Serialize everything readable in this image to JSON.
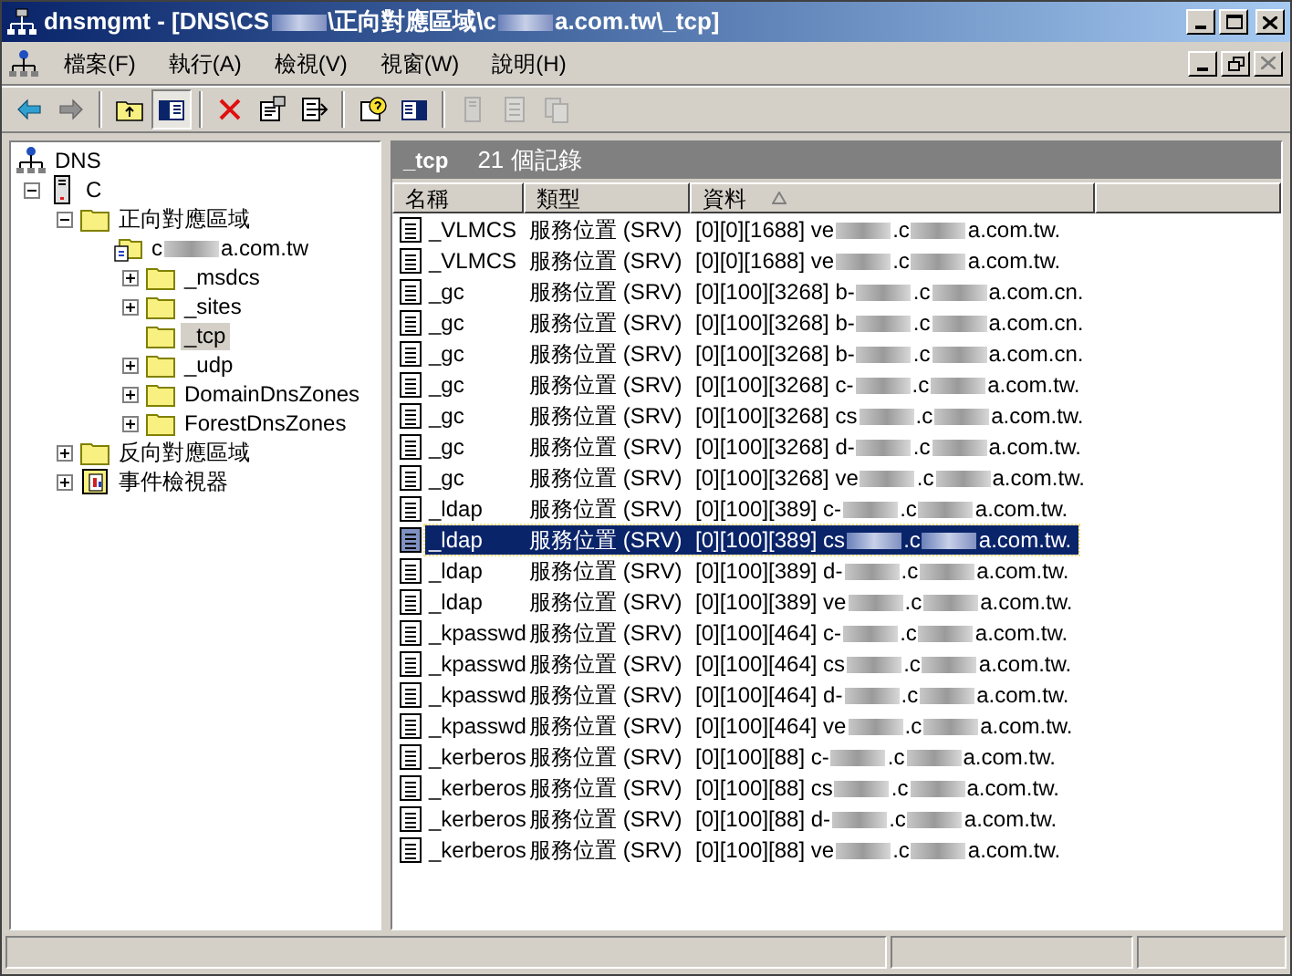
{
  "window": {
    "title": [
      "dnsmgmt - [DNS\\CS",
      "\\正向對應區域\\c",
      "a.com.tw\\_tcp]"
    ]
  },
  "menu": [
    {
      "label": "檔案(F)"
    },
    {
      "label": "執行(A)"
    },
    {
      "label": "檢視(V)"
    },
    {
      "label": "視窗(W)"
    },
    {
      "label": "說明(H)"
    }
  ],
  "toolbar": [
    {
      "kind": "back",
      "disabled": false
    },
    {
      "kind": "forward",
      "disabled": false
    },
    {
      "kind": "sep"
    },
    {
      "kind": "up",
      "disabled": false
    },
    {
      "kind": "tree",
      "disabled": false,
      "pressed": true
    },
    {
      "kind": "sep"
    },
    {
      "kind": "delete",
      "disabled": false
    },
    {
      "kind": "properties",
      "disabled": false
    },
    {
      "kind": "export",
      "disabled": false
    },
    {
      "kind": "sep"
    },
    {
      "kind": "help",
      "disabled": false
    },
    {
      "kind": "pane",
      "disabled": false
    },
    {
      "kind": "sep"
    },
    {
      "kind": "server",
      "disabled": true
    },
    {
      "kind": "doc",
      "disabled": true
    },
    {
      "kind": "copy",
      "disabled": true
    }
  ],
  "tree": [
    {
      "kind": "dns",
      "label": [
        "DNS"
      ],
      "selected": false,
      "children": [
        {
          "kind": "server",
          "label": [
            "C"
          ],
          "expanded": true,
          "selected": false,
          "children": [
            {
              "kind": "folder",
              "label": [
                "正向對應區域"
              ],
              "expanded": true,
              "selected": false,
              "children": [
                {
                  "kind": "zone",
                  "label": [
                    "c",
                    "a.com.tw"
                  ],
                  "selected": false,
                  "children": [
                    {
                      "kind": "folder",
                      "label": [
                        "_msdcs"
                      ],
                      "expanded": false,
                      "selected": false
                    },
                    {
                      "kind": "folder",
                      "label": [
                        "_sites"
                      ],
                      "expanded": false,
                      "selected": false
                    },
                    {
                      "kind": "folder",
                      "label": [
                        "_tcp"
                      ],
                      "selected": true
                    },
                    {
                      "kind": "folder",
                      "label": [
                        "_udp"
                      ],
                      "expanded": false,
                      "selected": false
                    },
                    {
                      "kind": "folder",
                      "label": [
                        "DomainDnsZones"
                      ],
                      "expanded": false,
                      "selected": false
                    },
                    {
                      "kind": "folder",
                      "label": [
                        "ForestDnsZones"
                      ],
                      "expanded": false,
                      "selected": false
                    }
                  ]
                }
              ]
            },
            {
              "kind": "folder",
              "label": [
                "反向對應區域"
              ],
              "expanded": false,
              "selected": false
            },
            {
              "kind": "event",
              "label": [
                "事件檢視器"
              ],
              "expanded": false,
              "selected": false
            }
          ]
        }
      ]
    }
  ],
  "pane_header": {
    "title": "_tcp",
    "count": "21 個記錄"
  },
  "columns": [
    {
      "label": "名稱",
      "sorted": false
    },
    {
      "label": "類型",
      "sorted": false
    },
    {
      "label": "資料",
      "sorted": true
    }
  ],
  "rows": [
    {
      "name": "_VLMCS",
      "type": "服務位置 (SRV)",
      "data": [
        "[0][0][1688] ve",
        ".c",
        "a.com.tw."
      ],
      "selected": false
    },
    {
      "name": "_VLMCS",
      "type": "服務位置 (SRV)",
      "data": [
        "[0][0][1688] ve",
        ".c",
        "a.com.tw."
      ],
      "selected": false
    },
    {
      "name": "_gc",
      "type": "服務位置 (SRV)",
      "data": [
        "[0][100][3268] b-",
        ".c",
        "a.com.cn."
      ],
      "selected": false
    },
    {
      "name": "_gc",
      "type": "服務位置 (SRV)",
      "data": [
        "[0][100][3268] b-",
        ".c",
        "a.com.cn."
      ],
      "selected": false
    },
    {
      "name": "_gc",
      "type": "服務位置 (SRV)",
      "data": [
        "[0][100][3268] b-",
        ".c",
        "a.com.cn."
      ],
      "selected": false
    },
    {
      "name": "_gc",
      "type": "服務位置 (SRV)",
      "data": [
        "[0][100][3268] c-",
        ".c",
        "a.com.tw."
      ],
      "selected": false
    },
    {
      "name": "_gc",
      "type": "服務位置 (SRV)",
      "data": [
        "[0][100][3268] cs",
        ".c",
        "a.com.tw."
      ],
      "selected": false
    },
    {
      "name": "_gc",
      "type": "服務位置 (SRV)",
      "data": [
        "[0][100][3268] d-",
        ".c",
        "a.com.tw."
      ],
      "selected": false
    },
    {
      "name": "_gc",
      "type": "服務位置 (SRV)",
      "data": [
        "[0][100][3268] ve",
        ".c",
        "a.com.tw."
      ],
      "selected": false
    },
    {
      "name": "_ldap",
      "type": "服務位置 (SRV)",
      "data": [
        "[0][100][389] c-",
        ".c",
        "a.com.tw."
      ],
      "selected": false
    },
    {
      "name": "_ldap",
      "type": "服務位置 (SRV)",
      "data": [
        "[0][100][389] cs",
        ".c",
        "a.com.tw."
      ],
      "selected": true
    },
    {
      "name": "_ldap",
      "type": "服務位置 (SRV)",
      "data": [
        "[0][100][389] d-",
        ".c",
        "a.com.tw."
      ],
      "selected": false
    },
    {
      "name": "_ldap",
      "type": "服務位置 (SRV)",
      "data": [
        "[0][100][389] ve",
        ".c",
        "a.com.tw."
      ],
      "selected": false
    },
    {
      "name": "_kpasswd",
      "type": "服務位置 (SRV)",
      "data": [
        "[0][100][464] c-",
        ".c",
        "a.com.tw."
      ],
      "selected": false
    },
    {
      "name": "_kpasswd",
      "type": "服務位置 (SRV)",
      "data": [
        "[0][100][464] cs",
        ".c",
        "a.com.tw."
      ],
      "selected": false
    },
    {
      "name": "_kpasswd",
      "type": "服務位置 (SRV)",
      "data": [
        "[0][100][464] d-",
        ".c",
        "a.com.tw."
      ],
      "selected": false
    },
    {
      "name": "_kpasswd",
      "type": "服務位置 (SRV)",
      "data": [
        "[0][100][464] ve",
        ".c",
        "a.com.tw."
      ],
      "selected": false
    },
    {
      "name": "_kerberos",
      "type": "服務位置 (SRV)",
      "data": [
        "[0][100][88] c-",
        ".c",
        "a.com.tw."
      ],
      "selected": false
    },
    {
      "name": "_kerberos",
      "type": "服務位置 (SRV)",
      "data": [
        "[0][100][88] cs",
        ".c",
        "a.com.tw."
      ],
      "selected": false
    },
    {
      "name": "_kerberos",
      "type": "服務位置 (SRV)",
      "data": [
        "[0][100][88] d-",
        ".c",
        "a.com.tw."
      ],
      "selected": false
    },
    {
      "name": "_kerberos",
      "type": "服務位置 (SRV)",
      "data": [
        "[0][100][88] ve",
        ".c",
        "a.com.tw."
      ],
      "selected": false
    }
  ]
}
